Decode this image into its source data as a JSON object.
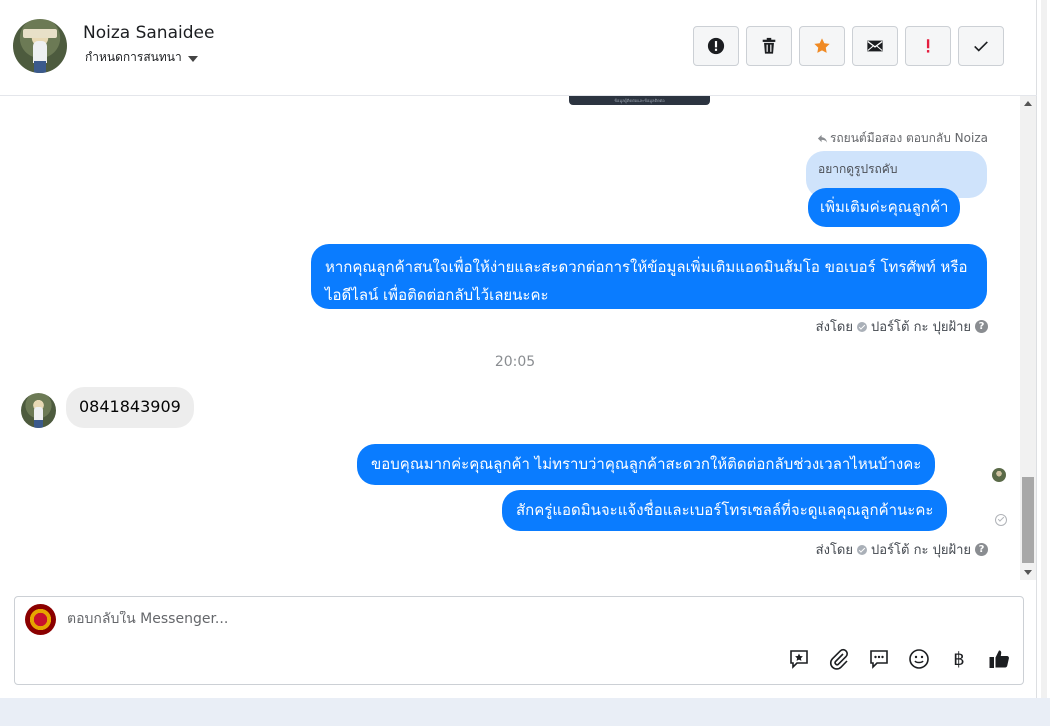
{
  "header": {
    "user_name": "Noiza Sanaidee",
    "conversation_settings": "กำหนดการสนทนา",
    "actions": [
      {
        "name": "report-button",
        "icon": "alert-circle-icon"
      },
      {
        "name": "delete-button",
        "icon": "trash-icon"
      },
      {
        "name": "star-button",
        "icon": "star-icon"
      },
      {
        "name": "mark-unread-button",
        "icon": "envelope-icon"
      },
      {
        "name": "important-button",
        "icon": "exclamation-icon"
      },
      {
        "name": "mark-done-button",
        "icon": "check-icon"
      }
    ]
  },
  "thread": {
    "image_stub_text": "ข้อมูลผู้ติดต่อและข้อมูลติดต่อ",
    "reply_meta": "รถยนต์มือสอง ตอบกลับ Noiza",
    "quoted_text": "อยากดูรูปรถคับ",
    "messages": [
      {
        "dir": "out",
        "text": "เพิ่มเติมค่ะคุณลูกค้า"
      },
      {
        "dir": "out",
        "text": "หากคุณลูกค้าสนใจเพื่อให้ง่ายและสะดวกต่อการให้ข้อมูลเพิ่มเติมแอดมินส้มโอ ขอเบอร์ โทรศัพท์ หรือ ไอดีไลน์ เพื่อติดต่อกลับไว้เลยนะคะ"
      },
      {
        "dir": "in",
        "text": "0841843909"
      },
      {
        "dir": "out",
        "text": "ขอบคุณมากค่ะคุณลูกค้า ไม่ทราบว่าคุณลูกค้าสะดวกให้ติดต่อกลับช่วงเวลาไหนบ้างคะ"
      },
      {
        "dir": "out",
        "text": "สักครู่แอดมินจะแจ้งชื่อและเบอร์โทรเซลล์ที่จะดูแลคุณลูกค้านะคะ"
      }
    ],
    "sent_by_prefix": "ส่งโดย",
    "sent_by_name": "ปอร์โต้ กะ ปุยฝ้าย",
    "help_glyph": "?",
    "timestamp": "20:05"
  },
  "composer": {
    "placeholder": "ตอบกลับใน Messenger...",
    "tools": [
      "saved-reply-icon",
      "paperclip-icon",
      "chat-bubble-icon",
      "smiley-icon",
      "baht-icon",
      "thumbs-up-icon"
    ],
    "baht_glyph": "฿"
  }
}
